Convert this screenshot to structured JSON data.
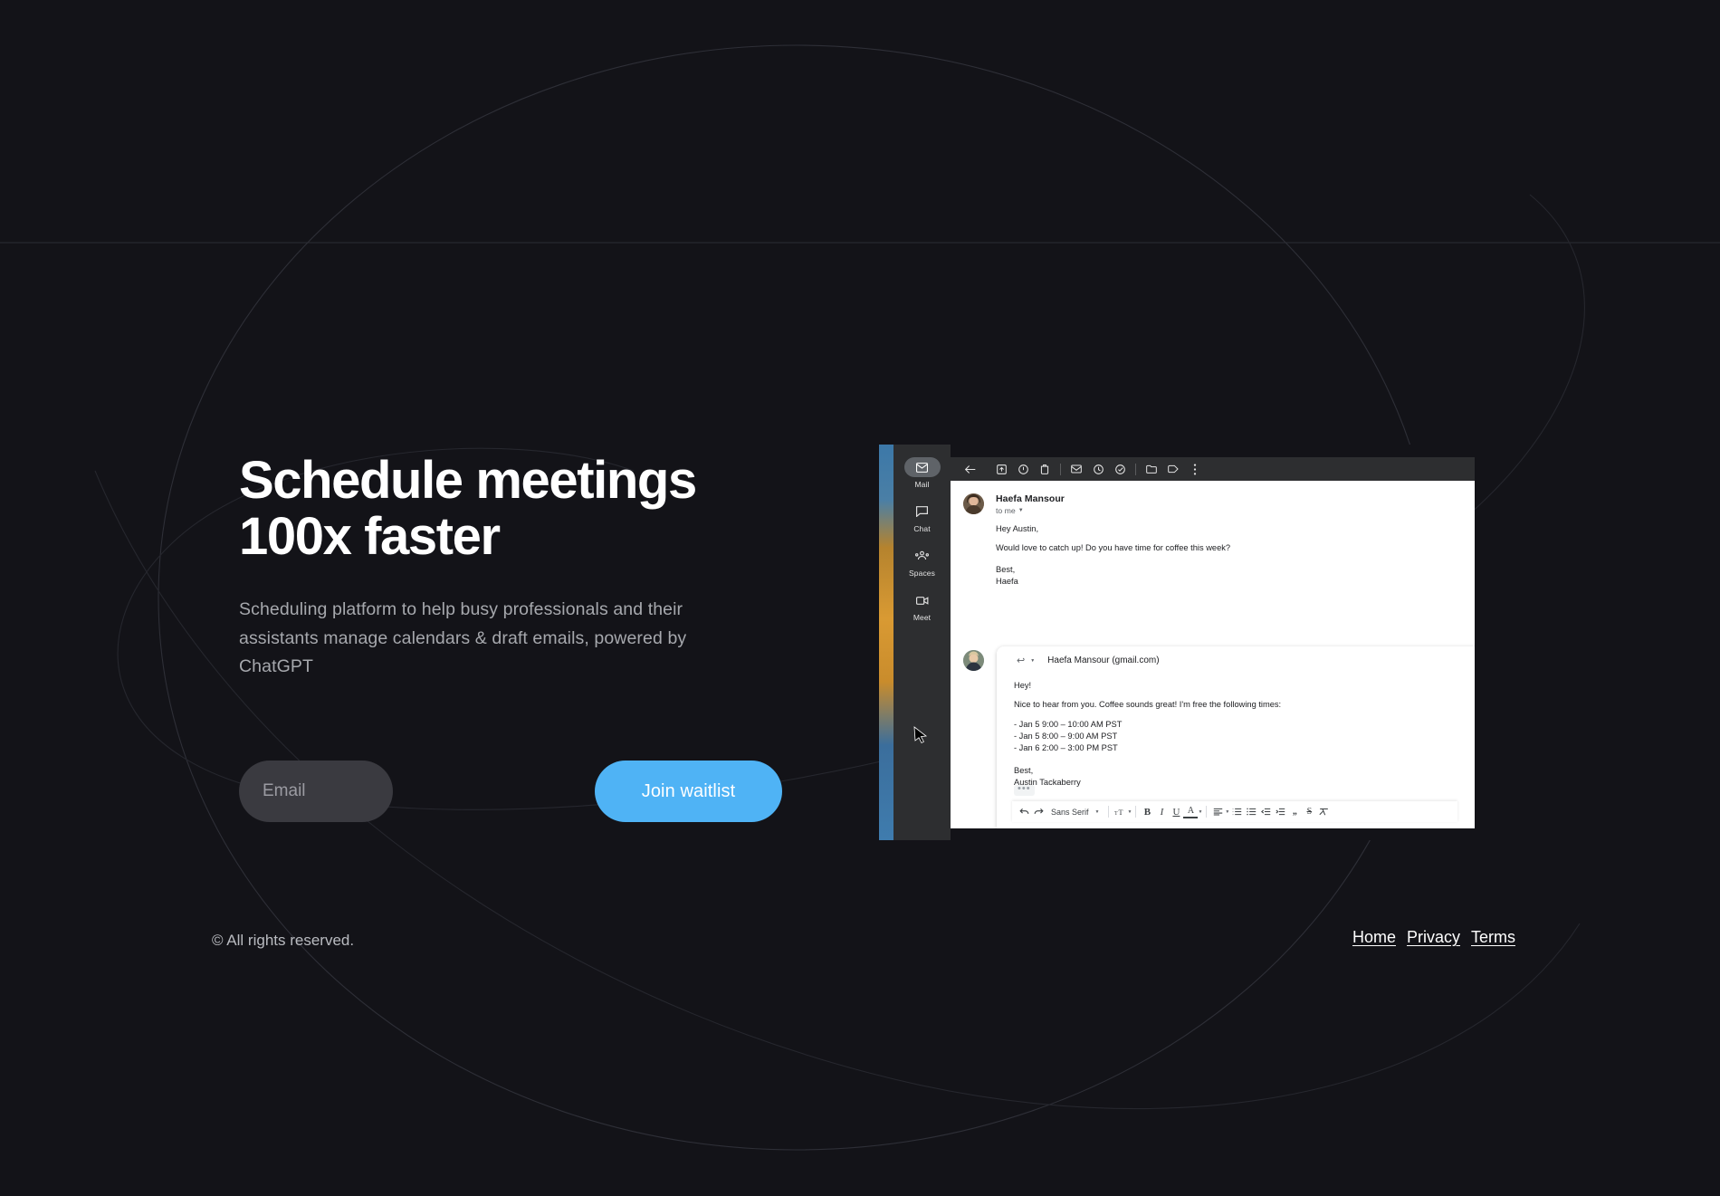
{
  "theme": {
    "background": "#131318",
    "accent": "#4fb3f5",
    "text_primary": "#ffffff",
    "text_secondary": "#a6a8ad",
    "input_bg": "#3a3a40"
  },
  "hero": {
    "headline_line1": "Schedule meetings",
    "headline_line2": "100x faster",
    "subhead": "Scheduling platform to help busy professionals and their assistants manage calendars & draft emails, powered by ChatGPT"
  },
  "cta": {
    "email_placeholder": "Email",
    "email_value": "",
    "join_label": "Join waitlist"
  },
  "footer": {
    "copyright": "© All rights reserved.",
    "links": [
      {
        "label": "Home"
      },
      {
        "label": "Privacy"
      },
      {
        "label": "Terms"
      }
    ]
  },
  "screenshot": {
    "sidebar": [
      {
        "label": "Mail",
        "icon": "mail-icon",
        "active": true
      },
      {
        "label": "Chat",
        "icon": "chat-icon",
        "active": false
      },
      {
        "label": "Spaces",
        "icon": "spaces-icon",
        "active": false
      },
      {
        "label": "Meet",
        "icon": "meet-icon",
        "active": false
      }
    ],
    "toolbar": [
      {
        "icon": "back-arrow-icon"
      },
      {
        "icon": "archive-icon"
      },
      {
        "icon": "report-spam-icon"
      },
      {
        "icon": "delete-icon"
      },
      {
        "icon": "mark-unread-icon"
      },
      {
        "icon": "snooze-icon"
      },
      {
        "icon": "add-to-tasks-icon"
      },
      {
        "icon": "move-to-icon"
      },
      {
        "icon": "label-icon"
      },
      {
        "icon": "more-options-icon"
      }
    ],
    "message": {
      "sender": "Haefa Mansour",
      "to_line": "to me",
      "greeting": "Hey Austin,",
      "paragraph": "Would love to catch up! Do you have time for coffee this week?",
      "signoff": "Best,",
      "signature": "Haefa"
    },
    "reply": {
      "recipient": "Haefa Mansour (gmail.com)",
      "greeting": "Hey!",
      "intro": "Nice to hear from you. Coffee sounds great! I'm free the following times:",
      "slots": [
        "- Jan 5 9:00 – 10:00 AM PST",
        "- Jan 5 8:00 – 9:00 AM PST",
        "- Jan 6 2:00 – 3:00 PM PST"
      ],
      "signoff": "Best,",
      "signature": "Austin Tackaberry",
      "show_trimmed": "•••",
      "format_toolbar": {
        "undo": "undo-icon",
        "redo": "redo-icon",
        "font_family": "Sans Serif",
        "font_size": "font-size-icon",
        "bold": "B",
        "italic": "I",
        "underline": "U",
        "text_color": "A",
        "align": "align-icon",
        "numbered_list": "numbered-list-icon",
        "bulleted_list": "bulleted-list-icon",
        "indent_less": "indent-less-icon",
        "indent_more": "indent-more-icon",
        "quote": "quote-icon",
        "strikethrough": "strikethrough-icon",
        "remove_formatting": "remove-formatting-icon"
      }
    }
  }
}
